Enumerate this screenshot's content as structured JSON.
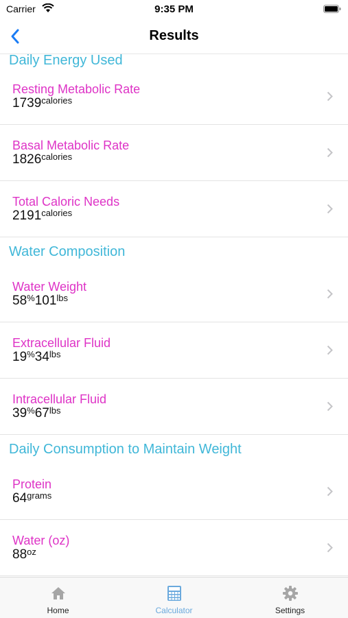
{
  "status_bar": {
    "carrier": "Carrier",
    "time": "9:35 PM"
  },
  "nav": {
    "title": "Results"
  },
  "sections": [
    {
      "header": "Daily Energy Used",
      "rows": [
        {
          "label": "Resting Metabolic Rate",
          "value": "1739",
          "unit": "calories"
        },
        {
          "label": "Basal Metabolic Rate",
          "value": "1826",
          "unit": "calories"
        },
        {
          "label": "Total Caloric Needs",
          "value": "2191",
          "unit": "calories"
        }
      ]
    },
    {
      "header": "Water Composition",
      "rows": [
        {
          "label": "Water Weight",
          "value": "58",
          "unit": "%",
          "value2": "101",
          "unit2": "lbs"
        },
        {
          "label": "Extracellular Fluid",
          "value": "19",
          "unit": "%",
          "value2": "34",
          "unit2": "lbs"
        },
        {
          "label": "Intracellular Fluid",
          "value": "39",
          "unit": "%",
          "value2": "67",
          "unit2": "lbs"
        }
      ]
    },
    {
      "header": "Daily Consumption to Maintain Weight",
      "rows": [
        {
          "label": "Protein",
          "value": "64",
          "unit": "grams"
        },
        {
          "label": "Water (oz)",
          "value": "88",
          "unit": "oz"
        }
      ]
    }
  ],
  "tabs": [
    {
      "label": "Home",
      "icon": "home-icon"
    },
    {
      "label": "Calculator",
      "icon": "calculator-icon",
      "active": true
    },
    {
      "label": "Settings",
      "icon": "gear-icon"
    }
  ],
  "colors": {
    "section_header": "#40b7d8",
    "row_label": "#de33c6",
    "tab_active": "#6aa9dd",
    "back": "#1a7cf5"
  }
}
